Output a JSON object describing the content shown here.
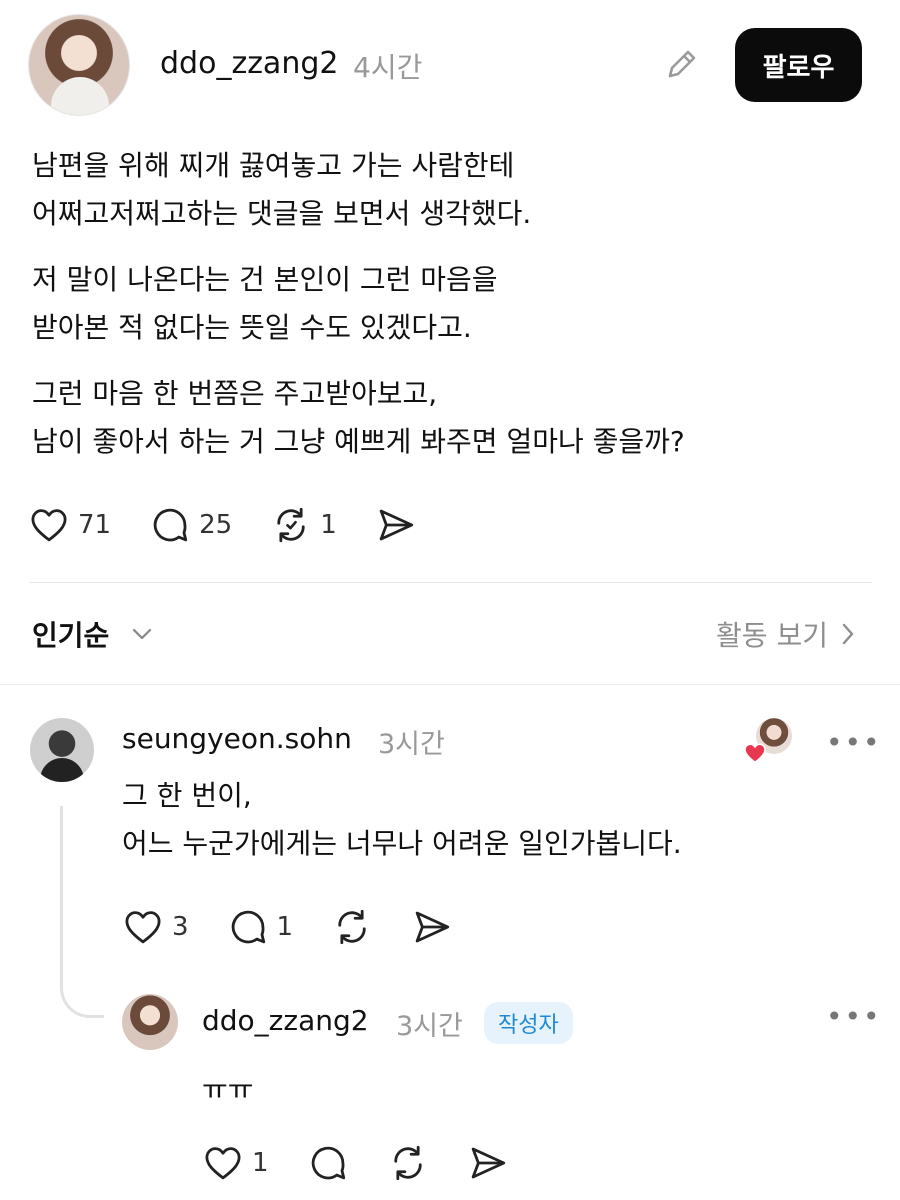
{
  "post": {
    "username": "ddo_zzang2",
    "time": "4시간",
    "follow_label": "팔로우",
    "paragraphs": [
      [
        "남편을 위해 찌개 끓여놓고 가는 사람한테",
        "어쩌고저쩌고하는 댓글을 보면서 생각했다."
      ],
      [
        "저 말이 나온다는 건 본인이 그런 마음을",
        "받아본 적 없다는 뜻일 수도 있겠다고."
      ],
      [
        "그런 마음 한 번쯤은 주고받아보고,",
        "남이 좋아서 하는 거 그냥 예쁘게 봐주면 얼마나 좋을까?"
      ]
    ],
    "likes": "71",
    "comments": "25",
    "reposts": "1"
  },
  "sort": {
    "label": "인기순",
    "activity_label": "활동 보기"
  },
  "comments": [
    {
      "username": "seungyeon.sohn",
      "time": "3시간",
      "lines": [
        "그 한 번이,",
        "어느 누군가에게는 너무나 어려운 일인가봅니다."
      ],
      "likes": "3",
      "replies": "1",
      "more": "•••"
    },
    {
      "username": "ddo_zzang2",
      "time": "3시간",
      "badge": "작성자",
      "lines": [
        "ㅠㅠ"
      ],
      "likes": "1",
      "more": "•••"
    }
  ],
  "colors": {
    "liked_heart": "#e8384f",
    "badge_bg": "#e6f3fc",
    "badge_text": "#1f8ad6"
  }
}
